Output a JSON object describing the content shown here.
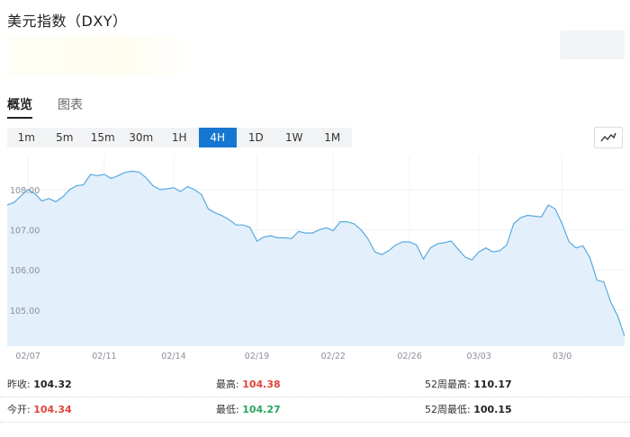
{
  "header": {
    "title": "美元指数（DXY）"
  },
  "tabs": [
    {
      "label": "概览",
      "active": true
    },
    {
      "label": "图表",
      "active": false
    }
  ],
  "intervals": [
    {
      "label": "1m",
      "active": false
    },
    {
      "label": "5m",
      "active": false
    },
    {
      "label": "15m",
      "active": false
    },
    {
      "label": "30m",
      "active": false
    },
    {
      "label": "1H",
      "active": false
    },
    {
      "label": "4H",
      "active": true
    },
    {
      "label": "1D",
      "active": false
    },
    {
      "label": "1W",
      "active": false
    },
    {
      "label": "1M",
      "active": false
    }
  ],
  "chart_type_icon": "line-chart-icon",
  "colors": {
    "accent": "#1677d2",
    "line": "#5aa9e0",
    "fill": "#e3f0fb",
    "up": "#e0453a",
    "down": "#2aa35f"
  },
  "chart_data": {
    "type": "area",
    "x_tick_labels": [
      "02/07",
      "02/11",
      "02/14",
      "02/19",
      "02/22",
      "02/26",
      "03/03",
      "03/0"
    ],
    "y_tick_labels": [
      "108.00",
      "107.00",
      "106.00",
      "105.00"
    ],
    "y_ticks": [
      108,
      107,
      106,
      105
    ],
    "ylim": [
      104.1,
      108.85
    ],
    "grid": true,
    "values": [
      107.62,
      107.68,
      107.85,
      108.0,
      107.9,
      107.72,
      107.78,
      107.7,
      107.82,
      108.0,
      108.1,
      108.12,
      108.38,
      108.35,
      108.38,
      108.28,
      108.35,
      108.43,
      108.46,
      108.44,
      108.3,
      108.1,
      108.0,
      108.02,
      108.05,
      107.95,
      108.08,
      108.0,
      107.88,
      107.52,
      107.42,
      107.35,
      107.25,
      107.12,
      107.12,
      107.06,
      106.72,
      106.82,
      106.85,
      106.8,
      106.8,
      106.78,
      106.96,
      106.92,
      106.92,
      107.0,
      107.05,
      106.98,
      107.2,
      107.2,
      107.15,
      107.0,
      106.78,
      106.45,
      106.38,
      106.48,
      106.62,
      106.7,
      106.7,
      106.62,
      106.27,
      106.55,
      106.65,
      106.68,
      106.72,
      106.52,
      106.32,
      106.25,
      106.45,
      106.55,
      106.45,
      106.48,
      106.62,
      107.15,
      107.3,
      107.36,
      107.34,
      107.32,
      107.62,
      107.52,
      107.15,
      106.7,
      106.55,
      106.6,
      106.3,
      105.75,
      105.7,
      105.2,
      104.85,
      104.35
    ],
    "x_tick_index": [
      3,
      14,
      24,
      36,
      47,
      58,
      68,
      80
    ]
  },
  "stats": {
    "prev_close_label": "昨收:",
    "prev_close": "104.32",
    "open_label": "今开:",
    "open": "104.34",
    "high_label": "最高:",
    "high": "104.38",
    "low_label": "最低:",
    "low": "104.27",
    "high52_label": "52周最高:",
    "high52": "110.17",
    "low52_label": "52周最低:",
    "low52": "100.15"
  }
}
